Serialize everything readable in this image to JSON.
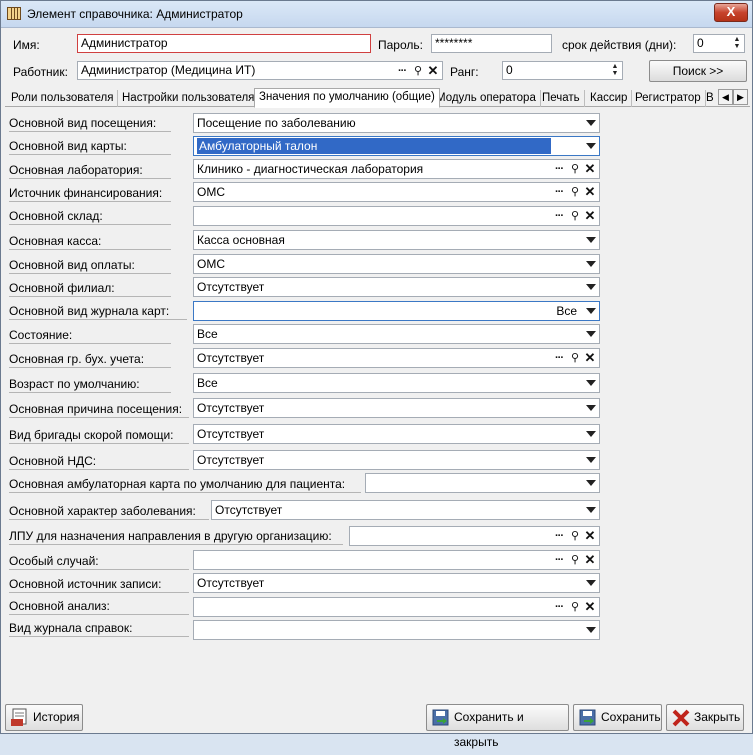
{
  "window": {
    "title": "Элемент справочника: Администратор",
    "close": "X"
  },
  "header": {
    "name_label": "Имя:",
    "name_value": "Администратор",
    "password_label": "Пароль:",
    "password_value": "********",
    "validity_label": "срок действия (дни):",
    "validity_value": "0",
    "worker_label": "Работник:",
    "worker_value": "Администратор (Медицина ИТ)",
    "rank_label": "Ранг:",
    "rank_value": "0",
    "search_button": "Поиск  >>"
  },
  "tabs": [
    "Роли пользователя",
    "Настройки пользователя",
    "Значения по умолчанию (общие)",
    "Модуль оператора",
    "Печать",
    "Кассир",
    "Регистратор",
    "В"
  ],
  "active_tab_index": 2,
  "fields": [
    {
      "label": "Основной вид посещения:",
      "value": "Посещение по заболеванию",
      "kind": "dropdown"
    },
    {
      "label": "Основной вид карты:",
      "value": "Амбулаторный талон",
      "kind": "dropdown",
      "selected": true
    },
    {
      "label": "Основная лаборатория:",
      "value": "Клинико - диагностическая лаборатория",
      "kind": "lookup"
    },
    {
      "label": "Источник финансирования:",
      "value": "ОМС",
      "kind": "lookup"
    },
    {
      "label": "Основной склад:",
      "value": "",
      "kind": "lookup"
    },
    {
      "label": "Основная касса:",
      "value": "Касса основная",
      "kind": "dropdown"
    },
    {
      "label": "Основной вид оплаты:",
      "value": "ОМС",
      "kind": "dropdown"
    },
    {
      "label": "Основной филиал:",
      "value": "Отсутствует",
      "kind": "dropdown"
    },
    {
      "label": "Основной вид журнала карт:",
      "value": "Все",
      "kind": "dropdown-right"
    },
    {
      "label": "Состояние:",
      "value": "Все",
      "kind": "dropdown"
    },
    {
      "label": "Основная гр. бух. учета:",
      "value": "Отсутствует",
      "kind": "lookup"
    },
    {
      "label": "Возраст по умолчанию:",
      "value": "Все",
      "kind": "dropdown"
    },
    {
      "label": "Основная причина посещения:",
      "value": "Отсутствует",
      "kind": "dropdown"
    },
    {
      "label": "Вид бригады скорой помощи:",
      "value": "Отсутствует",
      "kind": "dropdown"
    },
    {
      "label": "Основной НДС:",
      "value": "Отсутствует",
      "kind": "dropdown"
    },
    {
      "label": "Основная амбулаторная карта по умолчанию для пациента:",
      "value": "",
      "kind": "dropdown"
    },
    {
      "label": "Основной характер заболевания:",
      "value": "Отсутствует",
      "kind": "dropdown"
    },
    {
      "label": "ЛПУ для назначения направления в другую организацию:",
      "value": "",
      "kind": "lookup"
    },
    {
      "label": "Особый случай:",
      "value": "",
      "kind": "lookup"
    },
    {
      "label": "Основной источник записи:",
      "value": "Отсутствует",
      "kind": "dropdown"
    },
    {
      "label": "Основной анализ:",
      "value": "",
      "kind": "lookup"
    },
    {
      "label": "Вид журнала справок:",
      "value": "",
      "kind": "dropdown"
    }
  ],
  "icons": {
    "dots": "···",
    "search": "🔍",
    "clear": "✕"
  },
  "buttons": {
    "history": "История",
    "save_close": "Сохранить и закрыть",
    "save": "Сохранить",
    "close": "Закрыть"
  }
}
